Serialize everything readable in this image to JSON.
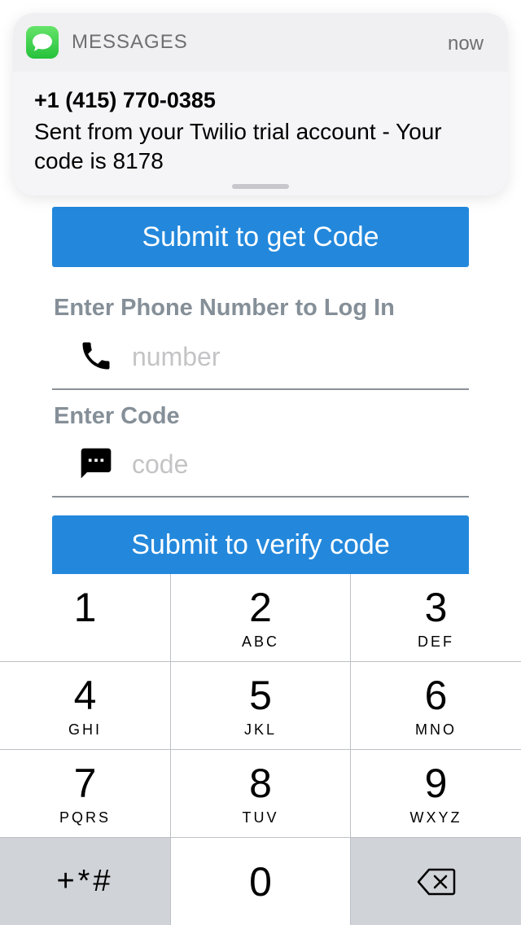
{
  "notification": {
    "app_name": "MESSAGES",
    "time": "now",
    "sender": "+1 (415) 770-0385",
    "body": "Sent from your Twilio trial account - Your code is 8178"
  },
  "form": {
    "get_code_button": "Submit to get Code",
    "phone_label": "Enter Phone Number to Log In",
    "phone_placeholder": "number",
    "code_label": "Enter Code",
    "code_placeholder": "code",
    "verify_button": "Submit to verify code"
  },
  "keypad": {
    "keys": [
      {
        "digit": "1",
        "letters": ""
      },
      {
        "digit": "2",
        "letters": "ABC"
      },
      {
        "digit": "3",
        "letters": "DEF"
      },
      {
        "digit": "4",
        "letters": "GHI"
      },
      {
        "digit": "5",
        "letters": "JKL"
      },
      {
        "digit": "6",
        "letters": "MNO"
      },
      {
        "digit": "7",
        "letters": "PQRS"
      },
      {
        "digit": "8",
        "letters": "TUV"
      },
      {
        "digit": "9",
        "letters": "WXYZ"
      }
    ],
    "symbols": "+*#",
    "zero": "0",
    "delete_icon": "backspace-icon"
  },
  "colors": {
    "accent_button": "#2388dc",
    "label_gray": "#858f98",
    "messages_green": "#25c13b"
  }
}
